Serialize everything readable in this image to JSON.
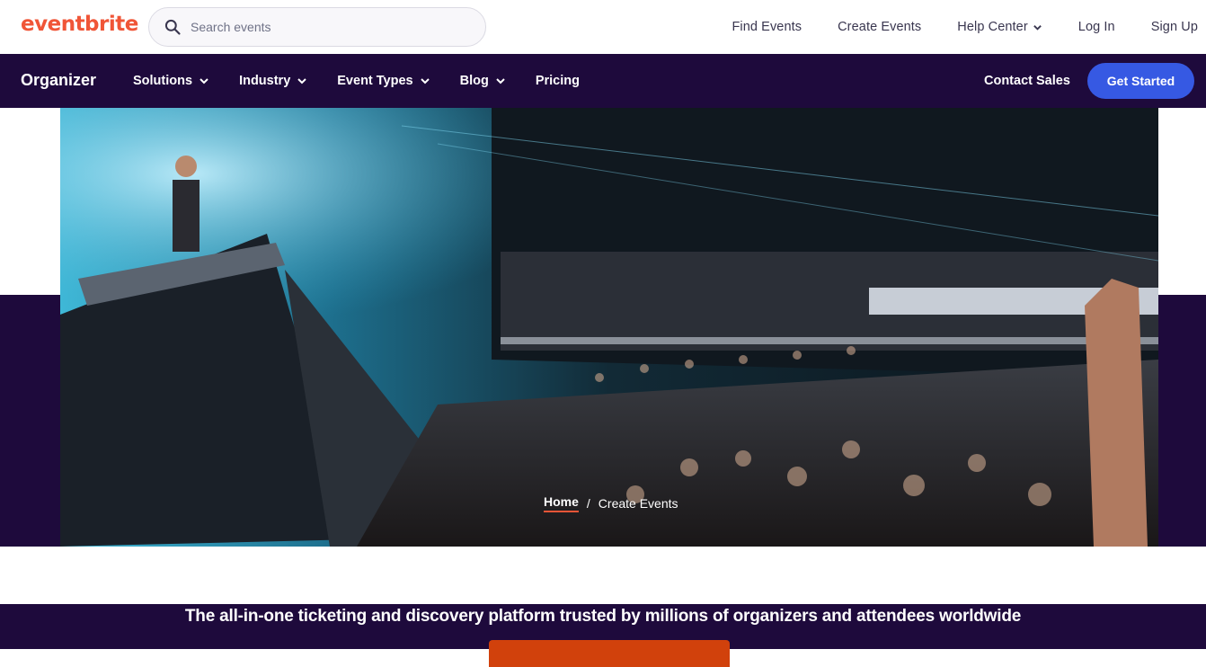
{
  "header": {
    "logo": "eventbrite",
    "search_placeholder": "Search events",
    "nav": [
      {
        "label": "Find Events"
      },
      {
        "label": "Create Events"
      },
      {
        "label": "Help Center"
      },
      {
        "label": "Log In"
      },
      {
        "label": "Sign Up"
      }
    ]
  },
  "organizer_bar": {
    "title": "Organizer",
    "menu": [
      {
        "label": "Solutions"
      },
      {
        "label": "Industry"
      },
      {
        "label": "Event Types"
      },
      {
        "label": "Blog"
      },
      {
        "label": "Pricing"
      }
    ],
    "contact_sales": "Contact Sales",
    "get_started": "Get Started"
  },
  "hero": {
    "breadcrumb": {
      "home": "Home",
      "separator": "/",
      "current": "Create Events"
    },
    "tagline": "The all-in-one ticketing and discovery platform trusted by millions of organizers and attendees worldwide"
  },
  "colors": {
    "brand_orange": "#f05537",
    "dark_purple": "#1e0a3c",
    "primary_blue": "#3659e3",
    "cta_orange": "#d1410c"
  }
}
